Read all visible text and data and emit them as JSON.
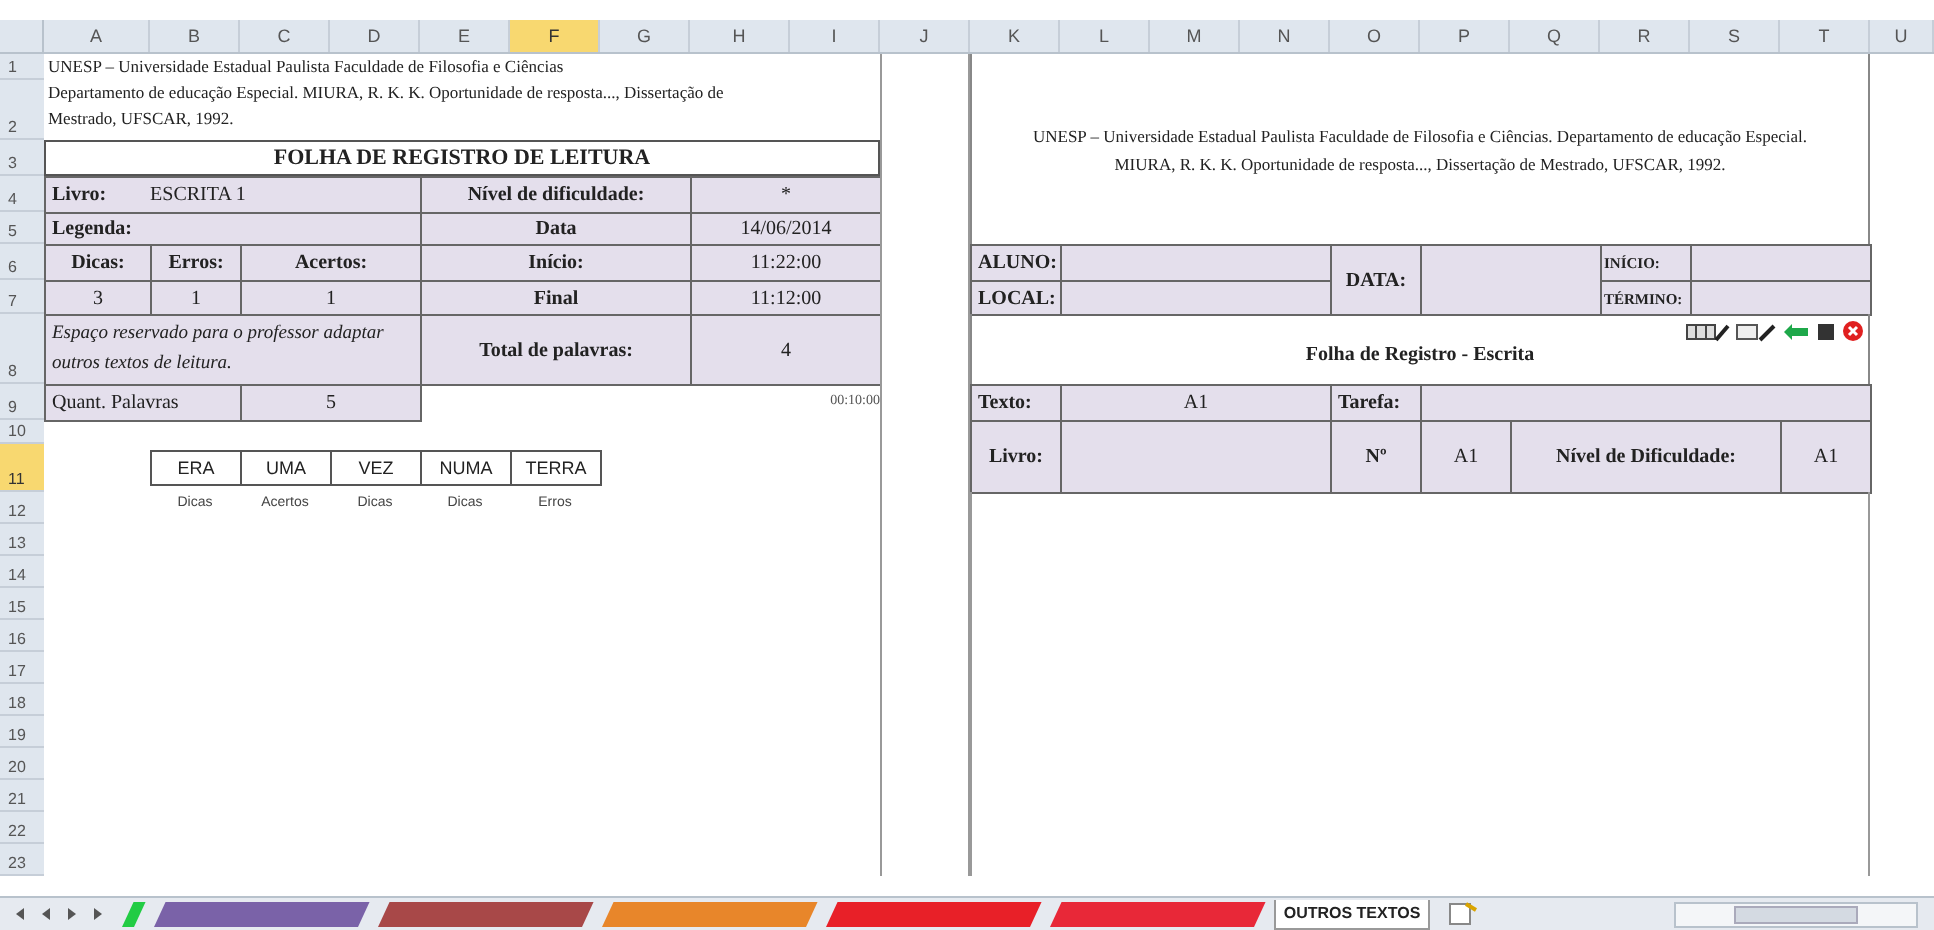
{
  "column_headers": [
    {
      "label": "A",
      "selected": false
    },
    {
      "label": "B",
      "selected": false
    },
    {
      "label": "C",
      "selected": false
    },
    {
      "label": "D",
      "selected": false
    },
    {
      "label": "E",
      "selected": false
    },
    {
      "label": "F",
      "selected": true
    },
    {
      "label": "G",
      "selected": false
    },
    {
      "label": "H",
      "selected": false
    },
    {
      "label": "I",
      "selected": false
    },
    {
      "label": "J",
      "selected": false
    },
    {
      "label": "K",
      "selected": false
    },
    {
      "label": "L",
      "selected": false
    },
    {
      "label": "M",
      "selected": false
    },
    {
      "label": "N",
      "selected": false
    },
    {
      "label": "O",
      "selected": false
    },
    {
      "label": "P",
      "selected": false
    },
    {
      "label": "Q",
      "selected": false
    },
    {
      "label": "R",
      "selected": false
    },
    {
      "label": "S",
      "selected": false
    },
    {
      "label": "T",
      "selected": false
    },
    {
      "label": "U",
      "selected": false
    }
  ],
  "row_headers": [
    {
      "label": "1",
      "selected": false
    },
    {
      "label": "2",
      "selected": false
    },
    {
      "label": "3",
      "selected": false
    },
    {
      "label": "4",
      "selected": false
    },
    {
      "label": "5",
      "selected": false
    },
    {
      "label": "6",
      "selected": false
    },
    {
      "label": "7",
      "selected": false
    },
    {
      "label": "8",
      "selected": false
    },
    {
      "label": "9",
      "selected": false
    },
    {
      "label": "10",
      "selected": false
    },
    {
      "label": "11",
      "selected": true
    },
    {
      "label": "12",
      "selected": false
    },
    {
      "label": "13",
      "selected": false
    },
    {
      "label": "14",
      "selected": false
    },
    {
      "label": "15",
      "selected": false
    },
    {
      "label": "16",
      "selected": false
    },
    {
      "label": "17",
      "selected": false
    },
    {
      "label": "18",
      "selected": false
    },
    {
      "label": "19",
      "selected": false
    },
    {
      "label": "20",
      "selected": false
    },
    {
      "label": "21",
      "selected": false
    },
    {
      "label": "22",
      "selected": false
    },
    {
      "label": "23",
      "selected": false
    }
  ],
  "left_sheet": {
    "citation_lines": [
      "UNESP – Universidade Estadual Paulista Faculdade de Filosofia e Ciências",
      "Departamento de educação Especial. MIURA, R. K. K. Oportunidade de resposta..., Dissertação de",
      "Mestrado, UFSCAR, 1992."
    ],
    "title": "FOLHA DE REGISTRO DE LEITURA",
    "book_label": "Livro:",
    "book": "ESCRITA 1",
    "difficulty_label": "Nível de dificuldade:",
    "difficulty": "*",
    "legend_label": "Legenda:",
    "date_label": "Data",
    "date": "14/06/2014",
    "hints_label": "Dicas:",
    "errors_label": "Erros:",
    "correct_label": "Acertos:",
    "start_label": "Início:",
    "start": "11:22:00",
    "hints": "3",
    "errors": "1",
    "correct": "1",
    "end_label": "Final",
    "end": "11:12:00",
    "note": "Espaço reservado para o professor adaptar outros textos de leitura.",
    "total_label": "Total de palavras:",
    "total": "4",
    "word_count_label": "Quant. Palavras",
    "word_count": "5",
    "elapsed": "00:10:00",
    "words": [
      {
        "word": "ERA",
        "result": "Dicas"
      },
      {
        "word": "UMA",
        "result": "Acertos"
      },
      {
        "word": "VEZ",
        "result": "Dicas"
      },
      {
        "word": "NUMA",
        "result": "Dicas"
      },
      {
        "word": "TERRA",
        "result": "Erros"
      }
    ]
  },
  "right_sheet": {
    "citation_lines": [
      "UNESP – Universidade Estadual Paulista Faculdade de Filosofia e Ciências. Departamento de educação Especial.",
      "MIURA, R. K. K. Oportunidade de resposta..., Dissertação de Mestrado, UFSCAR, 1992."
    ],
    "student_label": "ALUNO:",
    "place_label": "LOCAL:",
    "date_label": "DATA:",
    "start_label": "INÍCIO:",
    "end_label": "TÉRMINO:",
    "title": "Folha de Registro - Escrita",
    "text_label": "Texto:",
    "text": "A1",
    "task_label": "Tarefa:",
    "book_label": "Livro:",
    "number_label": "Nº",
    "number": "A1",
    "difficulty_label": "Nível de Dificuldade:",
    "difficulty": "A1"
  },
  "sheet_tabs": [
    {
      "color": "#22cc44",
      "selected": false
    },
    {
      "color": "#7a62a8",
      "selected": false
    },
    {
      "color": "#a84848",
      "selected": false
    },
    {
      "color": "#e8862a",
      "selected": false
    },
    {
      "color": "#e82028",
      "selected": false
    },
    {
      "color": "#e82838",
      "selected": false
    },
    {
      "label": "OUTROS TEXTOS",
      "color": "#ffffff",
      "selected": true
    }
  ]
}
